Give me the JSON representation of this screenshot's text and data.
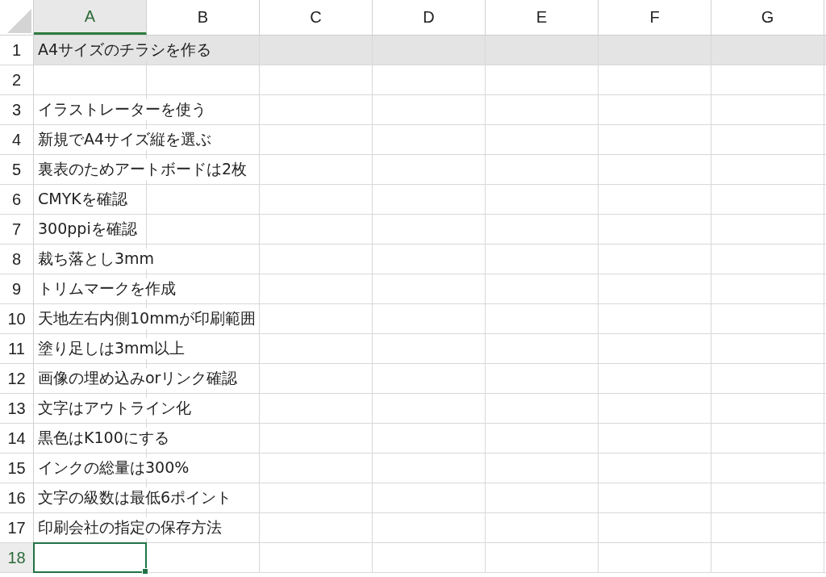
{
  "columns": [
    {
      "label": "A",
      "selected": true
    },
    {
      "label": "B",
      "selected": false
    },
    {
      "label": "C",
      "selected": false
    },
    {
      "label": "D",
      "selected": false
    },
    {
      "label": "E",
      "selected": false
    },
    {
      "label": "F",
      "selected": false
    },
    {
      "label": "G",
      "selected": false
    }
  ],
  "rows": [
    {
      "number": "1",
      "text": "A4サイズのチラシを作る",
      "highlighted": true,
      "selected": false
    },
    {
      "number": "2",
      "highlighted": false,
      "selected": false
    },
    {
      "number": "3",
      "text": "イラストレーターを使う",
      "highlighted": false,
      "selected": false
    },
    {
      "number": "4",
      "text": "新規でA4サイズ縦を選ぶ",
      "highlighted": false,
      "selected": false
    },
    {
      "number": "5",
      "text": "裏表のためアートボードは2枚",
      "highlighted": false,
      "selected": false
    },
    {
      "number": "6",
      "text": "CMYKを確認",
      "highlighted": false,
      "selected": false
    },
    {
      "number": "7",
      "text": "300ppiを確認",
      "highlighted": false,
      "selected": false
    },
    {
      "number": "8",
      "text": "裁ち落とし3mm",
      "highlighted": false,
      "selected": false
    },
    {
      "number": "9",
      "text": "トリムマークを作成",
      "highlighted": false,
      "selected": false
    },
    {
      "number": "10",
      "text": "天地左右内側10mmが印刷範囲",
      "highlighted": false,
      "selected": false
    },
    {
      "number": "11",
      "text": "塗り足しは3mm以上",
      "highlighted": false,
      "selected": false
    },
    {
      "number": "12",
      "text": "画像の埋め込みorリンク確認",
      "highlighted": false,
      "selected": false
    },
    {
      "number": "13",
      "text": "文字はアウトライン化",
      "highlighted": false,
      "selected": false
    },
    {
      "number": "14",
      "text": "黒色はK100にする",
      "highlighted": false,
      "selected": false
    },
    {
      "number": "15",
      "text": "インクの総量は300%",
      "highlighted": false,
      "selected": false
    },
    {
      "number": "16",
      "text": "文字の級数は最低6ポイント",
      "highlighted": false,
      "selected": false
    },
    {
      "number": "17",
      "text": "印刷会社の指定の保存方法",
      "highlighted": false,
      "selected": false
    },
    {
      "number": "18",
      "highlighted": false,
      "selected": true
    }
  ]
}
